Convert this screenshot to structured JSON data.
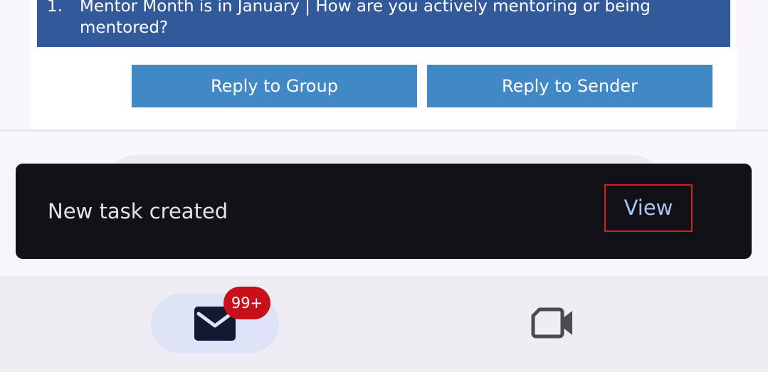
{
  "email": {
    "topic_number": "1.",
    "topic_text": "Mentor Month is in January | How are you actively mentoring or being mentored?",
    "reply_group_label": "Reply to Group",
    "reply_sender_label": "Reply to Sender"
  },
  "snackbar": {
    "message": "New task created",
    "action_label": "View"
  },
  "bottom_nav": {
    "mail": {
      "icon": "mail-icon",
      "badge": "99+"
    },
    "meet": {
      "icon": "video-icon"
    }
  },
  "colors": {
    "banner": "#325a9a",
    "reply_button": "#4189c6",
    "snackbar": "#111117",
    "snackbar_action": "#a8c4f4",
    "badge": "#c8101b",
    "highlight_box": "#d61d22"
  }
}
